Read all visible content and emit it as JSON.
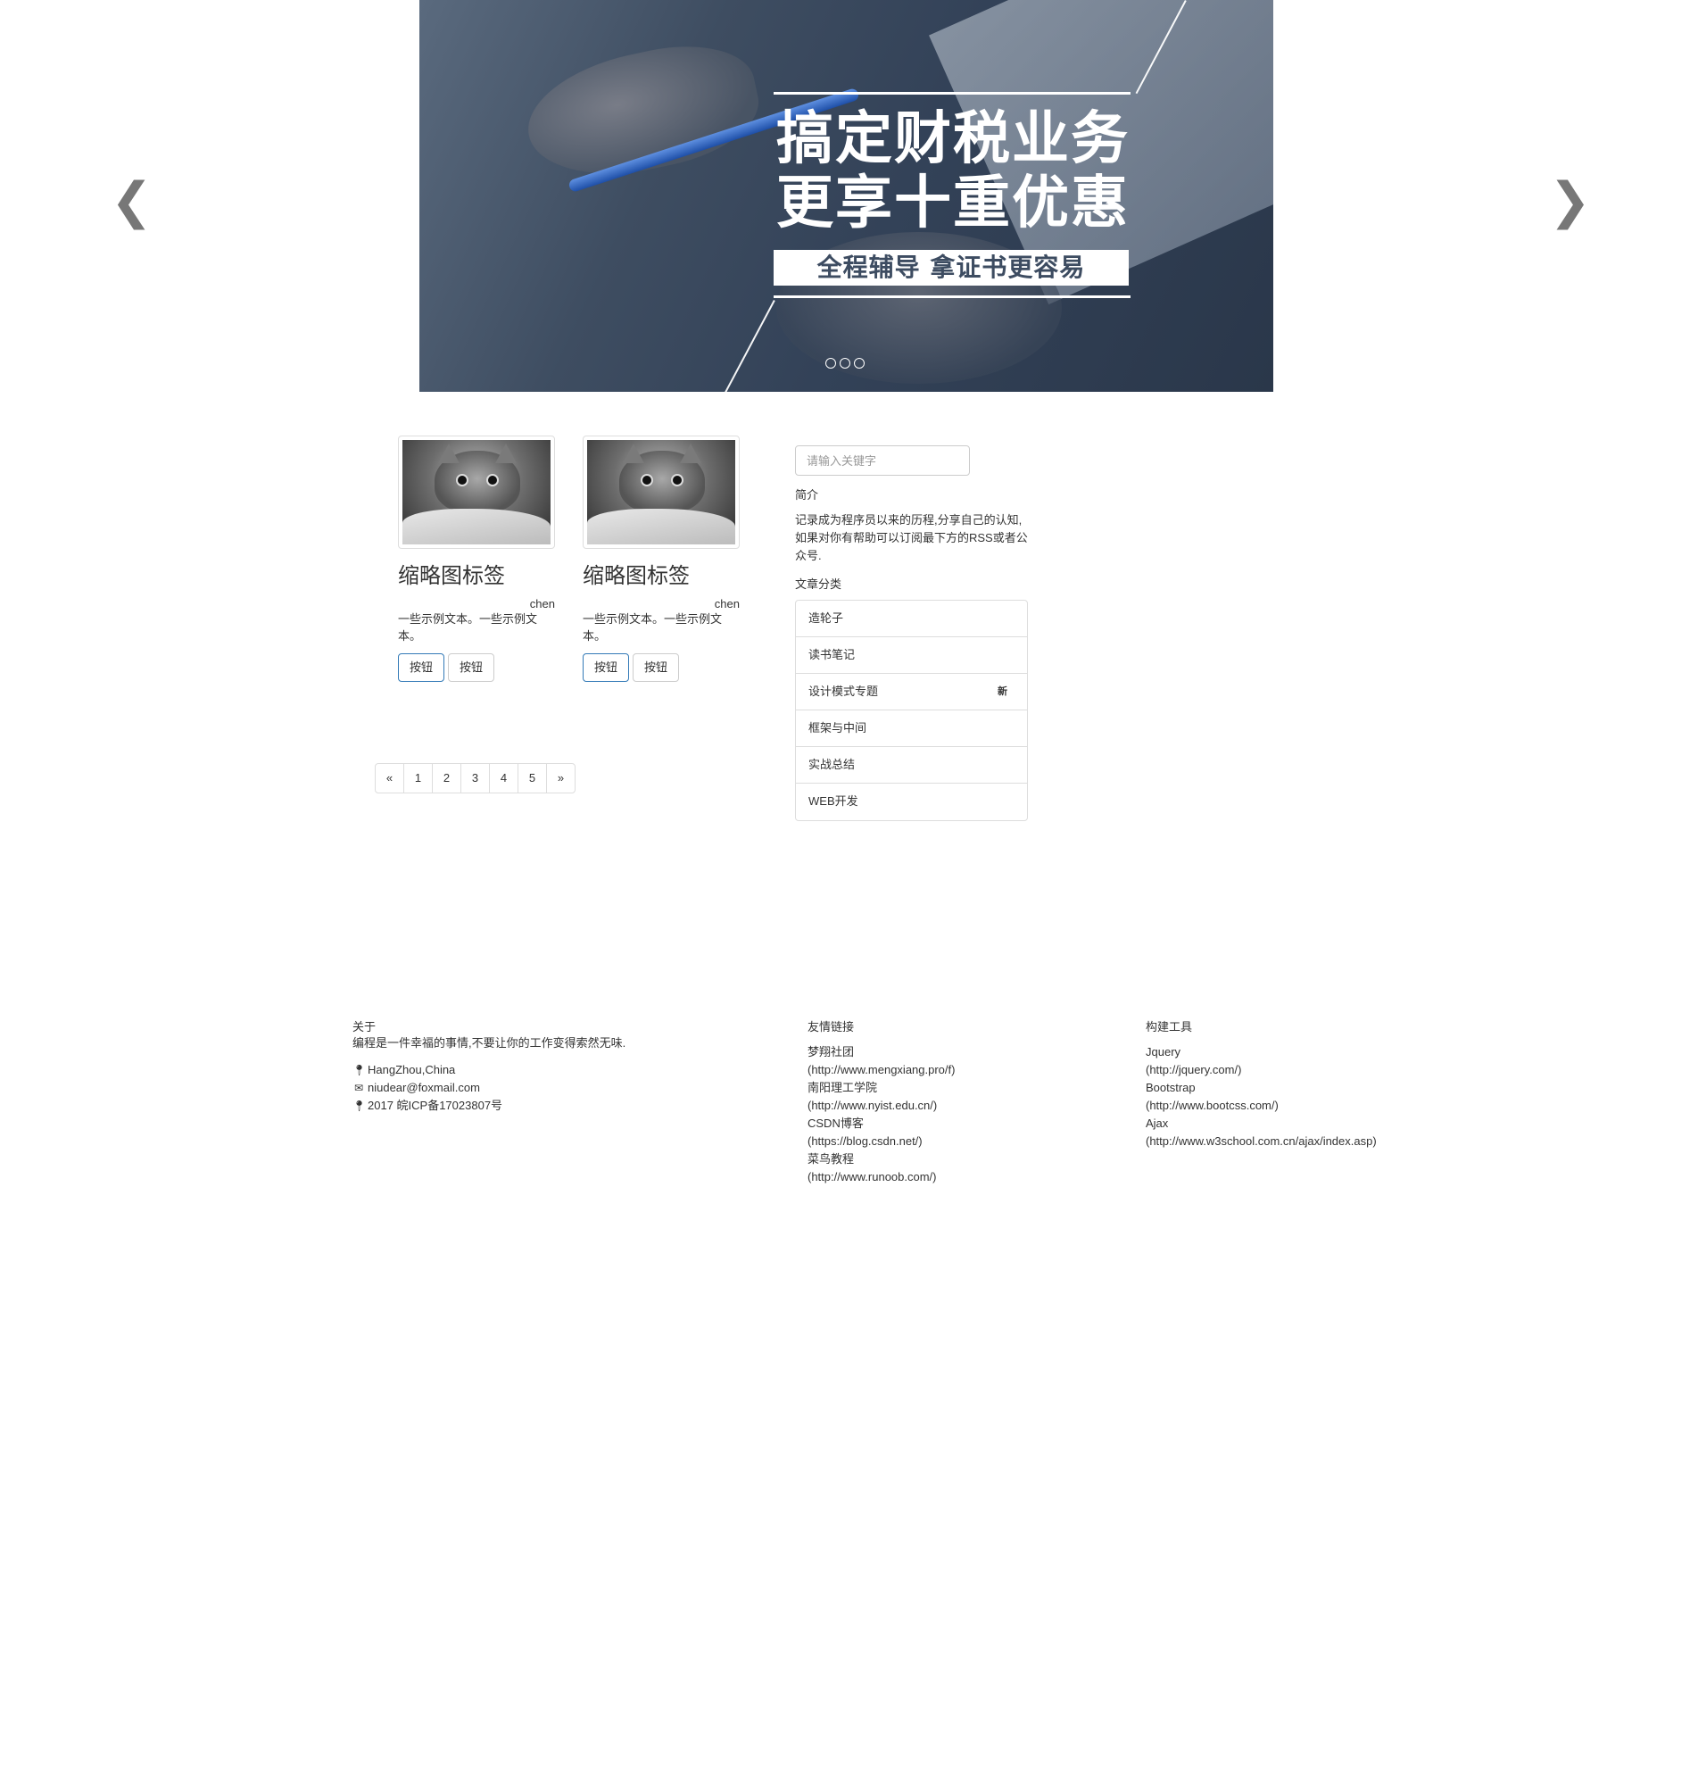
{
  "carousel": {
    "headline_line1": "搞定财税业务",
    "headline_line2": "更享十重优惠",
    "subline": "全程辅导 拿证书更容易",
    "prev_arrow": "❮",
    "next_arrow": "❯",
    "slides_total": 3,
    "active_slide": 1
  },
  "thumbnails": [
    {
      "title": "缩略图标签",
      "author": "chen",
      "text": "一些示例文本。一些示例文本。",
      "btn_primary": "按钮",
      "btn_default": "按钮"
    },
    {
      "title": "缩略图标签",
      "author": "chen",
      "text": "一些示例文本。一些示例文本。",
      "btn_primary": "按钮",
      "btn_default": "按钮"
    }
  ],
  "pagination": [
    "«",
    "1",
    "2",
    "3",
    "4",
    "5",
    "»"
  ],
  "sidebar": {
    "search_placeholder": "请输入关键字",
    "intro_title": "简介",
    "intro_text": "记录成为程序员以来的历程,分享自己的认知, 如果对你有帮助可以订阅最下方的RSS或者公众号.",
    "categories_title": "文章分类",
    "categories": [
      {
        "label": "造轮子",
        "badge": ""
      },
      {
        "label": "读书笔记",
        "badge": ""
      },
      {
        "label": "设计模式专题",
        "badge": "新"
      },
      {
        "label": "框架与中间",
        "badge": ""
      },
      {
        "label": "实战总结",
        "badge": ""
      },
      {
        "label": "WEB开发",
        "badge": ""
      }
    ]
  },
  "footer": {
    "about": {
      "title": "关于",
      "motto": "编程是一件幸福的事情,不要让你的工作变得索然无味.",
      "location": "HangZhou,China",
      "email": "niudear@foxmail.com",
      "icp": "2017 皖ICP备17023807号"
    },
    "links": {
      "title": "友情链接",
      "items": [
        {
          "name": "梦翔社团",
          "url": "(http://www.mengxiang.pro/f)"
        },
        {
          "name": "南阳理工学院",
          "url": "(http://www.nyist.edu.cn/)"
        },
        {
          "name": "CSDN博客",
          "url": "(https://blog.csdn.net/)"
        },
        {
          "name": "菜鸟教程",
          "url": "(http://www.runoob.com/)"
        }
      ]
    },
    "tools": {
      "title": "构建工具",
      "items": [
        {
          "name": "Jquery",
          "url": "(http://jquery.com/)"
        },
        {
          "name": "Bootstrap",
          "url": "(http://www.bootcss.com/)"
        },
        {
          "name": "Ajax",
          "url": "(http://www.w3school.com.cn/ajax/index.asp)"
        }
      ]
    }
  },
  "icons": {
    "location": "map-marker-icon",
    "email": "envelope-icon",
    "icp": "map-marker-icon"
  }
}
